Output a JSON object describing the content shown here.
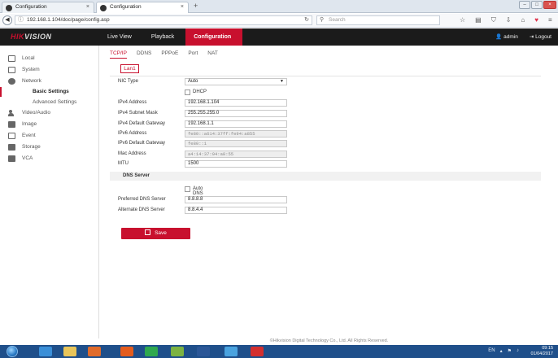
{
  "browser": {
    "tabs": [
      {
        "title": "Configuration",
        "active": false
      },
      {
        "title": "Configuration",
        "active": true
      }
    ],
    "new_tab": "+",
    "url": "192.168.1.104/doc/page/config.asp",
    "search_placeholder": "Search"
  },
  "app": {
    "logo_hik": "HIK",
    "logo_vision": "VISION",
    "nav": [
      "Live View",
      "Playback",
      "Configuration"
    ],
    "active_nav": "Configuration",
    "user": "admin",
    "logout": "Logout"
  },
  "sidebar": {
    "items": [
      {
        "label": "Local",
        "icon": "monitor-icon"
      },
      {
        "label": "System",
        "icon": "system-icon"
      },
      {
        "label": "Network",
        "icon": "globe-icon"
      },
      {
        "label": "Video/Audio",
        "icon": "video-audio-icon"
      },
      {
        "label": "Image",
        "icon": "image-icon"
      },
      {
        "label": "Event",
        "icon": "event-icon"
      },
      {
        "label": "Storage",
        "icon": "storage-icon"
      },
      {
        "label": "VCA",
        "icon": "vca-icon"
      }
    ],
    "network_sub": [
      "Basic Settings",
      "Advanced Settings"
    ],
    "active_sub": "Basic Settings"
  },
  "content": {
    "subtabs": [
      "TCP/IP",
      "DDNS",
      "PPPoE",
      "Port",
      "NAT"
    ],
    "active_subtab": "TCP/IP",
    "lan_button": "Lan1",
    "nic_type": {
      "label": "NIC Type",
      "value": "Auto"
    },
    "dhcp": {
      "label": "DHCP",
      "checked": false
    },
    "ipv4_address": {
      "label": "IPv4 Address",
      "value": "192.168.1.104"
    },
    "ipv4_mask": {
      "label": "IPv4 Subnet Mask",
      "value": "255.255.255.0"
    },
    "ipv4_gateway": {
      "label": "IPv4 Default Gateway",
      "value": "192.168.1.1"
    },
    "ipv6_address": {
      "label": "IPv6 Address",
      "value": "fe80::a614:37ff:fe94:a855"
    },
    "ipv6_gateway": {
      "label": "IPv6 Default Gateway",
      "value": "fe80::1"
    },
    "mac_address": {
      "label": "Mac Address",
      "value": "a4:14:37:94:a8:55"
    },
    "mtu": {
      "label": "MTU",
      "value": "1500"
    },
    "dns_section": "DNS Server",
    "auto_dns": {
      "label": "Auto DNS",
      "checked": false
    },
    "preferred_dns": {
      "label": "Preferred DNS Server",
      "value": "8.8.8.8"
    },
    "alternate_dns": {
      "label": "Alternate DNS Server",
      "value": "8.8.4.4"
    },
    "save_label": "Save",
    "footer": "©Hikvision Digital Technology Co., Ltd. All Rights Reserved."
  },
  "taskbar": {
    "lang": "EN",
    "time": "09:15",
    "date": "01/04/2017"
  },
  "colors": {
    "accent": "#c8102e",
    "header_bg": "#1b1b1b",
    "taskbar_bg": "#1f4f8a"
  }
}
